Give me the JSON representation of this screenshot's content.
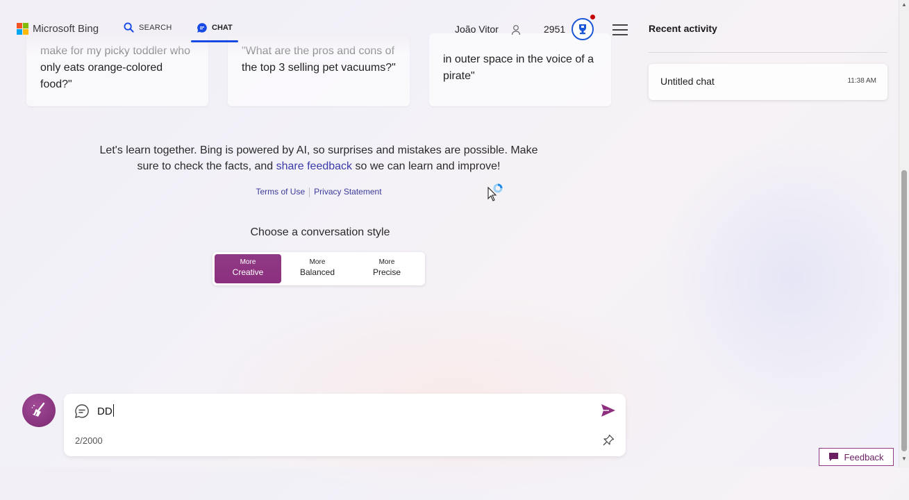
{
  "header": {
    "logo_text": "Microsoft Bing",
    "nav_search": "SEARCH",
    "nav_chat": "CHAT",
    "user_name": "João Vitor",
    "points": "2951",
    "accent_color": "#174ae4"
  },
  "suggestions": [
    {
      "faded": "make for my picky toddler who",
      "text": "only eats orange-colored food?\""
    },
    {
      "faded": "\"What are the pros and cons of",
      "text": "the top 3 selling pet vacuums?\""
    },
    {
      "faded": "in outer space in the voice of a",
      "text": "pirate\""
    }
  ],
  "disclaimer": {
    "before": "Let's learn together. Bing is powered by AI, so surprises and mistakes are possible. Make sure to check the facts, and ",
    "link": "share feedback",
    "after": " so we can learn and improve!"
  },
  "links": {
    "terms": "Terms of Use",
    "privacy": "Privacy Statement"
  },
  "conversation_style": {
    "title": "Choose a conversation style",
    "options": [
      {
        "small": "More",
        "big": "Creative",
        "selected": true
      },
      {
        "small": "More",
        "big": "Balanced",
        "selected": false
      },
      {
        "small": "More",
        "big": "Precise",
        "selected": false
      }
    ],
    "selected_color": "#8c2f7e"
  },
  "input": {
    "value": "DD",
    "counter": "2/2000"
  },
  "sidebar": {
    "title": "Recent activity",
    "chats": [
      {
        "name": "Untitled chat",
        "time": "11:38 AM"
      }
    ]
  },
  "feedback_label": "Feedback",
  "icons": [
    "search-icon",
    "chat-icon",
    "user-icon",
    "rewards-icon",
    "menu-icon",
    "broom-icon",
    "send-icon",
    "pin-icon",
    "feedback-icon"
  ]
}
